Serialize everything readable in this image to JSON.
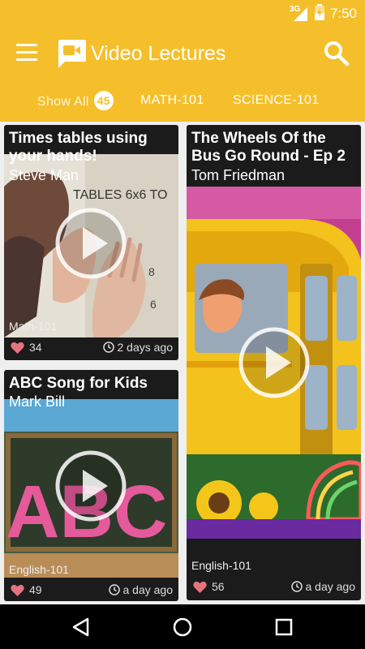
{
  "status_bar": {
    "network": "3G",
    "time": "7:50"
  },
  "app_bar": {
    "title": "Video Lectures",
    "logo_icon": "video-camera-icon",
    "menu_icon": "hamburger-menu-icon",
    "search_icon": "search-icon"
  },
  "tabs": {
    "show_all": {
      "label": "Show All",
      "count": "45"
    },
    "math": {
      "label": "MATH-101"
    },
    "science": {
      "label": "SCIENCE-101"
    }
  },
  "videos": [
    {
      "title": "Times tables using your hands!",
      "author": "Steve Man",
      "course": "Math-101",
      "likes": "34",
      "time": "2 days ago"
    },
    {
      "title": "The Wheels Of the Bus Go Round - Ep 2",
      "author": "Tom Friedman",
      "course": "English-101",
      "likes": "56",
      "time": "a day ago"
    },
    {
      "title": "ABC Song for Kids",
      "author": "Mark Bill",
      "course": "English-101",
      "likes": "49",
      "time": "a day ago"
    }
  ],
  "thumb_text": {
    "tables": "TABLES 6x6 TO",
    "abc": "ABC"
  },
  "colors": {
    "accent": "#f5bf2b",
    "heart": "#e5737d",
    "card_bg": "#1b1b1b"
  }
}
